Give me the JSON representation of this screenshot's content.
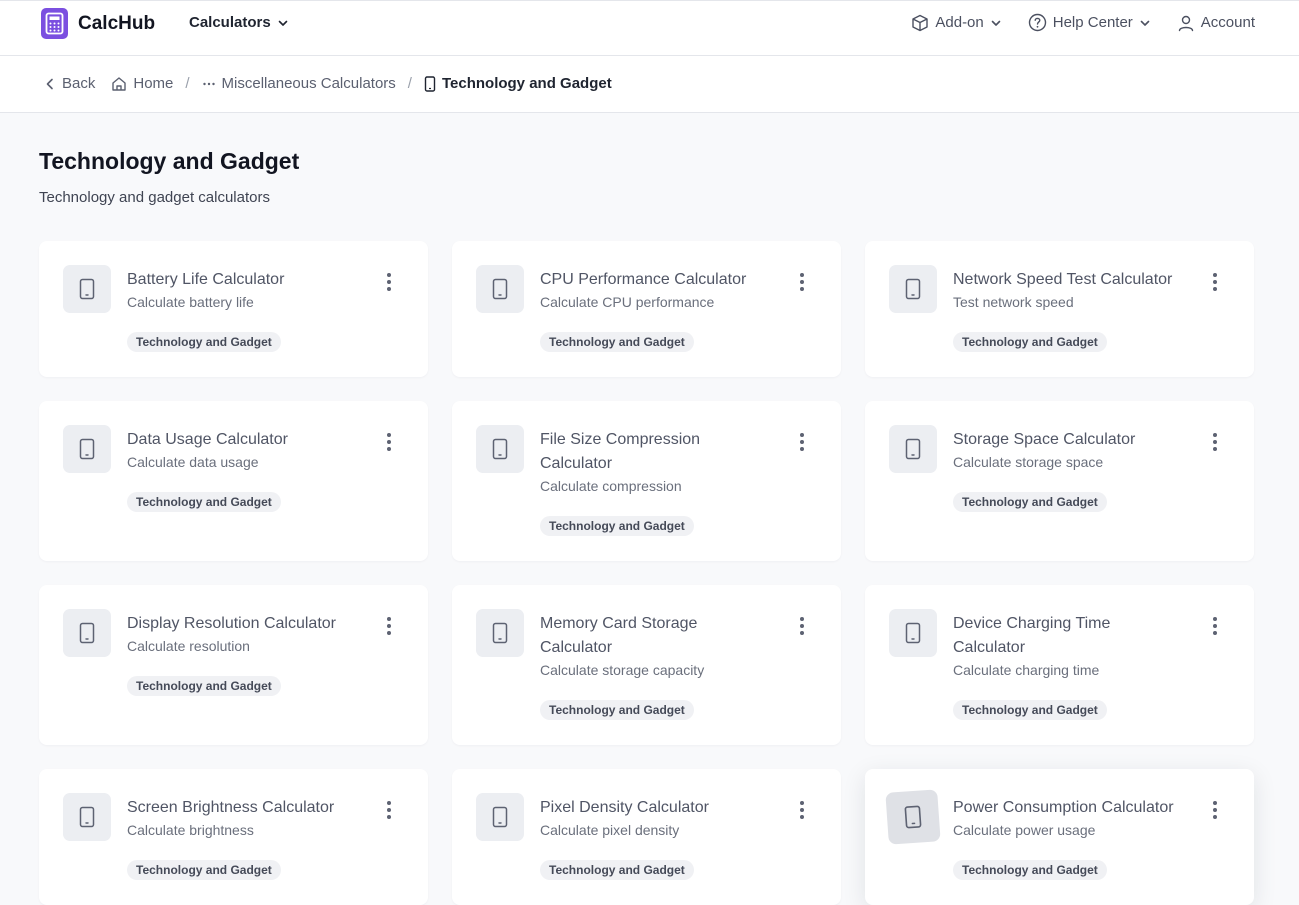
{
  "header": {
    "brand": "CalcHub",
    "calculators_label": "Calculators",
    "addon_label": "Add-on",
    "help_label": "Help Center",
    "account_label": "Account"
  },
  "breadcrumb": {
    "back": "Back",
    "home": "Home",
    "parent": "Miscellaneous Calculators",
    "current": "Technology and Gadget"
  },
  "page": {
    "title": "Technology and Gadget",
    "subtitle": "Technology and gadget calculators"
  },
  "cards": [
    {
      "title": "Battery Life Calculator",
      "desc": "Calculate battery life",
      "tag": "Technology and Gadget"
    },
    {
      "title": "CPU Performance Calculator",
      "desc": "Calculate CPU performance",
      "tag": "Technology and Gadget"
    },
    {
      "title": "Network Speed Test Calculator",
      "desc": "Test network speed",
      "tag": "Technology and Gadget"
    },
    {
      "title": "Data Usage Calculator",
      "desc": "Calculate data usage",
      "tag": "Technology and Gadget"
    },
    {
      "title": "File Size Compression Calculator",
      "desc": "Calculate compression",
      "tag": "Technology and Gadget"
    },
    {
      "title": "Storage Space Calculator",
      "desc": "Calculate storage space",
      "tag": "Technology and Gadget"
    },
    {
      "title": "Display Resolution Calculator",
      "desc": "Calculate resolution",
      "tag": "Technology and Gadget"
    },
    {
      "title": "Memory Card Storage Calculator",
      "desc": "Calculate storage capacity",
      "tag": "Technology and Gadget"
    },
    {
      "title": "Device Charging Time Calculator",
      "desc": "Calculate charging time",
      "tag": "Technology and Gadget"
    },
    {
      "title": "Screen Brightness Calculator",
      "desc": "Calculate brightness",
      "tag": "Technology and Gadget"
    },
    {
      "title": "Pixel Density Calculator",
      "desc": "Calculate pixel density",
      "tag": "Technology and Gadget"
    },
    {
      "title": "Power Consumption Calculator",
      "desc": "Calculate power usage",
      "tag": "Technology and Gadget"
    }
  ],
  "colors": {
    "brand": "#7b4fe0",
    "background": "#f8f9fb"
  }
}
